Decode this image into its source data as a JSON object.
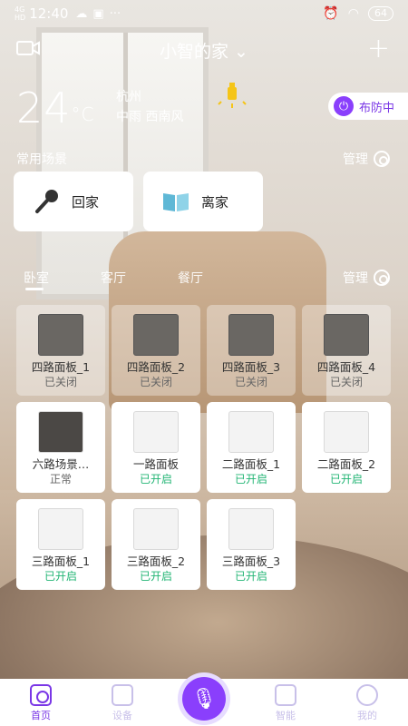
{
  "status_bar": {
    "network": "4G\nHD",
    "time": "12:40",
    "battery": "64"
  },
  "header": {
    "home_name": "小智的家",
    "add_label": "+"
  },
  "weather": {
    "temperature": "24",
    "unit": "°C",
    "city": "杭州",
    "condition": "中雨 西南风"
  },
  "security": {
    "label": "布防中"
  },
  "scenes": {
    "title": "常用场景",
    "manage_label": "管理",
    "items": [
      {
        "label": "回家",
        "icon": "microphone-icon"
      },
      {
        "label": "离家",
        "icon": "book-icon"
      }
    ]
  },
  "rooms": {
    "tabs": [
      "卧室",
      "客厅",
      "餐厅"
    ],
    "active_tab": "卧室",
    "manage_label": "管理"
  },
  "devices": [
    {
      "name": "四路面板_1",
      "status": "已关闭",
      "state": "off"
    },
    {
      "name": "四路面板_2",
      "status": "已关闭",
      "state": "off"
    },
    {
      "name": "四路面板_3",
      "status": "已关闭",
      "state": "off"
    },
    {
      "name": "四路面板_4",
      "status": "已关闭",
      "state": "off"
    },
    {
      "name": "六路场景…",
      "status": "正常",
      "state": "normal"
    },
    {
      "name": "一路面板",
      "status": "已开启",
      "state": "on"
    },
    {
      "name": "二路面板_1",
      "status": "已开启",
      "state": "on"
    },
    {
      "name": "二路面板_2",
      "status": "已开启",
      "state": "on"
    },
    {
      "name": "三路面板_1",
      "status": "已开启",
      "state": "on"
    },
    {
      "name": "三路面板_2",
      "status": "已开启",
      "state": "on"
    },
    {
      "name": "三路面板_3",
      "status": "已开启",
      "state": "on"
    }
  ],
  "bottom_nav": [
    {
      "label": "首页",
      "icon": "home-icon",
      "active": true
    },
    {
      "label": "设备",
      "icon": "grid-icon",
      "active": false
    },
    {
      "label": "智能",
      "icon": "cast-icon",
      "active": false
    },
    {
      "label": "我的",
      "icon": "person-icon",
      "active": false
    }
  ],
  "colors": {
    "accent": "#8a3ffc",
    "on_status": "#22b574"
  }
}
